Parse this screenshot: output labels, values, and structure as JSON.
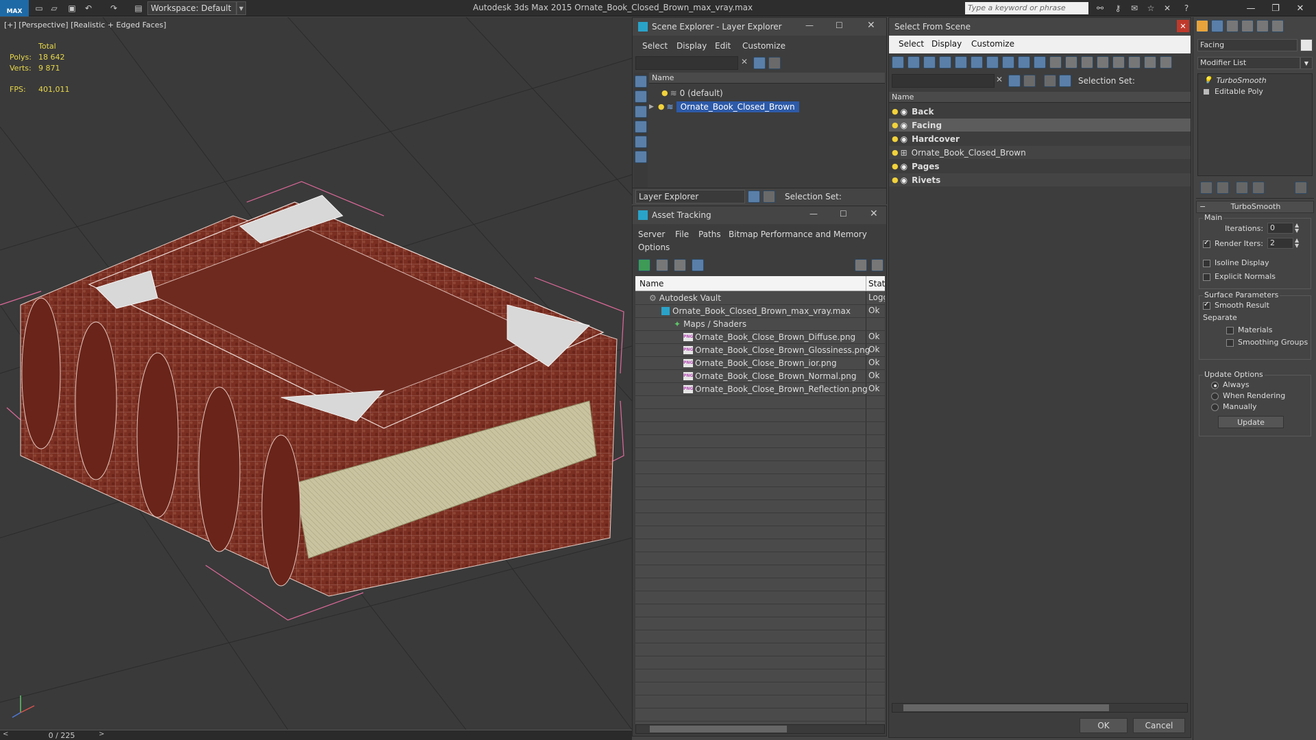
{
  "titlebar": {
    "logo": "MAX",
    "workspace": "Workspace: Default",
    "app_title": "Autodesk 3ds Max  2015    Ornate_Book_Closed_Brown_max_vray.max",
    "search_placeholder": "Type a keyword or phrase"
  },
  "viewport": {
    "label": "[+] [Perspective] [Realistic + Edged Faces]",
    "stats": {
      "total_label": "Total",
      "polys_label": "Polys:",
      "polys": "18 642",
      "verts_label": "Verts:",
      "verts": "9 871",
      "fps_label": "FPS:",
      "fps": "401,011"
    },
    "frame_counter": "0 / 225"
  },
  "scene_explorer": {
    "title": "Scene Explorer - Layer Explorer",
    "menus": [
      "Select",
      "Display",
      "Edit",
      "Customize"
    ],
    "column": "Name",
    "rows": [
      "0 (default)",
      "Ornate_Book_Closed_Brown"
    ],
    "footer_dropdown": "Layer Explorer",
    "selection_set": "Selection Set:"
  },
  "asset_tracking": {
    "title": "Asset Tracking",
    "menus": [
      "Server",
      "File",
      "Paths",
      "Bitmap Performance and Memory",
      "Options"
    ],
    "col_name": "Name",
    "col_status": "Stat",
    "rows": [
      {
        "name": "Autodesk Vault",
        "status": "Logg"
      },
      {
        "name": "Ornate_Book_Closed_Brown_max_vray.max",
        "status": "Ok"
      },
      {
        "name": "Maps / Shaders",
        "status": ""
      },
      {
        "name": "Ornate_Book_Close_Brown_Diffuse.png",
        "status": "Ok"
      },
      {
        "name": "Ornate_Book_Close_Brown_Glossiness.png",
        "status": "Ok"
      },
      {
        "name": "Ornate_Book_Close_Brown_ior.png",
        "status": "Ok"
      },
      {
        "name": "Ornate_Book_Close_Brown_Normal.png",
        "status": "Ok"
      },
      {
        "name": "Ornate_Book_Close_Brown_Reflection.png",
        "status": "Ok"
      }
    ]
  },
  "select_from_scene": {
    "title": "Select From Scene",
    "menus": [
      "Select",
      "Display",
      "Customize"
    ],
    "selection_set": "Selection Set:",
    "column": "Name",
    "rows": [
      "Back",
      "Facing",
      "Hardcover",
      "Ornate_Book_Closed_Brown",
      "Pages",
      "Rivets"
    ],
    "ok": "OK",
    "cancel": "Cancel"
  },
  "command_panel": {
    "object_name": "Facing",
    "modifier_list": "Modifier List",
    "stack": [
      "TurboSmooth",
      "Editable Poly"
    ],
    "rollout_title": "TurboSmooth",
    "main_label": "Main",
    "iterations_label": "Iterations:",
    "iterations": "0",
    "render_iters_label": "Render Iters:",
    "render_iters": "2",
    "isoline": "Isoline Display",
    "explicit_normals": "Explicit Normals",
    "surface_params": "Surface Parameters",
    "smooth_result": "Smooth Result",
    "separate": "Separate",
    "materials": "Materials",
    "smoothing_groups": "Smoothing Groups",
    "update_options": "Update Options",
    "always": "Always",
    "when_rendering": "When Rendering",
    "manually": "Manually",
    "update_button": "Update"
  }
}
